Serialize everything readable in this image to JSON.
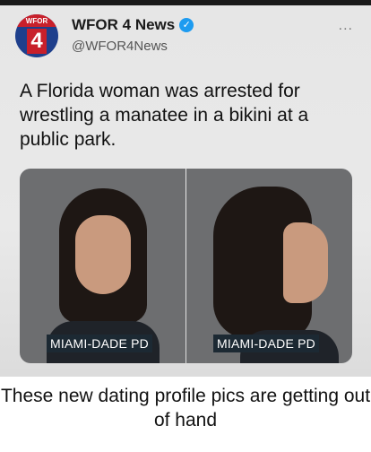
{
  "tweet": {
    "logo_text": "WFOR",
    "logo_number": "4",
    "display_name": "WFOR 4 News",
    "handle": "@WFOR4News",
    "more_label": "...",
    "text": "A Florida woman was arrested for wrestling a manatee in a bikini at a public park.",
    "photos": [
      {
        "label": "MIAMI-DADE PD"
      },
      {
        "label": "MIAMI-DADE PD"
      }
    ]
  },
  "caption": "These new dating profile pics are getting out of hand",
  "colors": {
    "verified": "#1d9bf0",
    "logo_blue": "#1e3f8c",
    "logo_red": "#c8202b"
  }
}
